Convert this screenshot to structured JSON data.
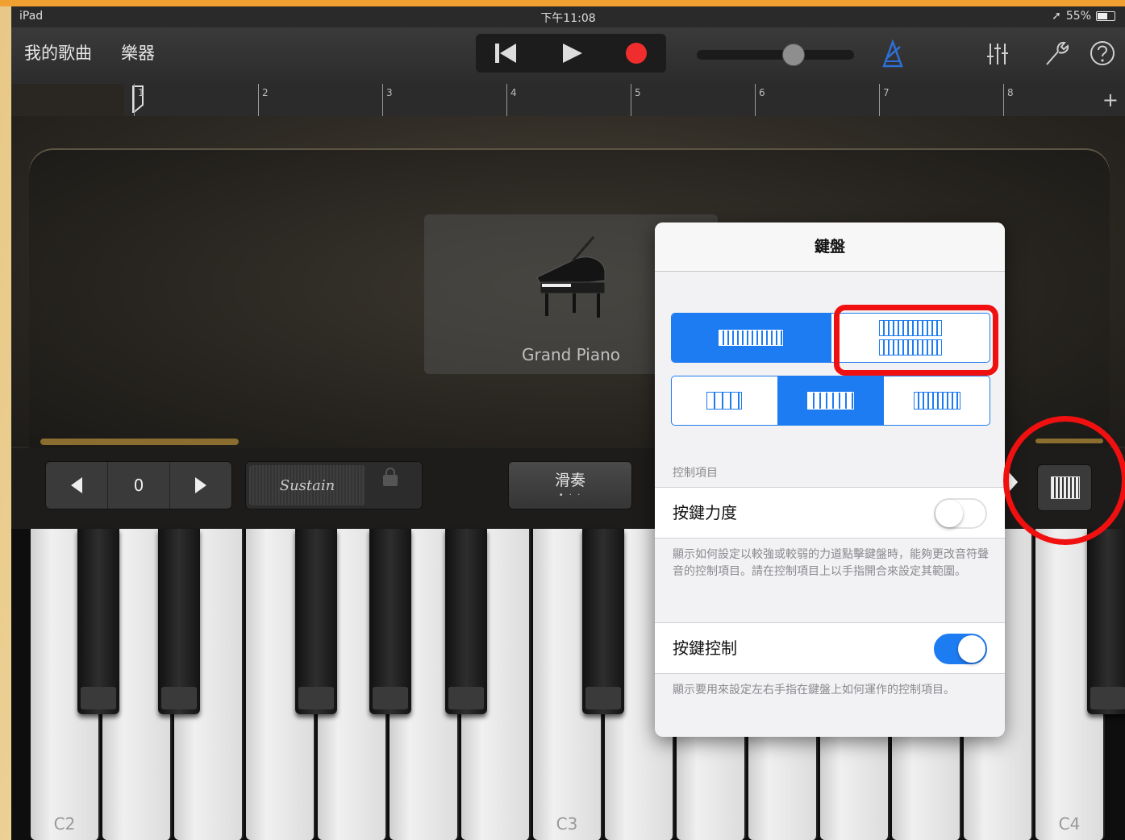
{
  "status": {
    "device": "iPad",
    "time": "下午11:08",
    "battery": "55%"
  },
  "toolbar": {
    "my_songs": "我的歌曲",
    "instruments": "樂器"
  },
  "ruler": {
    "bars": [
      "1",
      "2",
      "3",
      "4",
      "5",
      "6",
      "7",
      "8"
    ]
  },
  "instrument": {
    "name": "Grand Piano"
  },
  "controls": {
    "octave_value": "0",
    "sustain_label": "Sustain",
    "glide_label": "滑奏",
    "glide_dots": "• · ·"
  },
  "keyboard": {
    "notes": [
      "C2",
      "C3",
      "C4"
    ]
  },
  "popover": {
    "title": "鍵盤",
    "section_label": "控制項目",
    "velocity_label": "按鍵力度",
    "velocity_on": false,
    "velocity_desc": "顯示如何設定以較強或較弱的力道點擊鍵盤時，能夠更改音符聲音的控制項目。請在控制項目上以手指開合來設定其範圍。",
    "keycontrol_label": "按鍵控制",
    "keycontrol_on": true,
    "keycontrol_desc": "顯示要用來設定左右手指在鍵盤上如何運作的控制項目。"
  },
  "colors": {
    "accent": "#1e7cf2",
    "highlight": "#f01010",
    "record": "#f02d2d"
  }
}
